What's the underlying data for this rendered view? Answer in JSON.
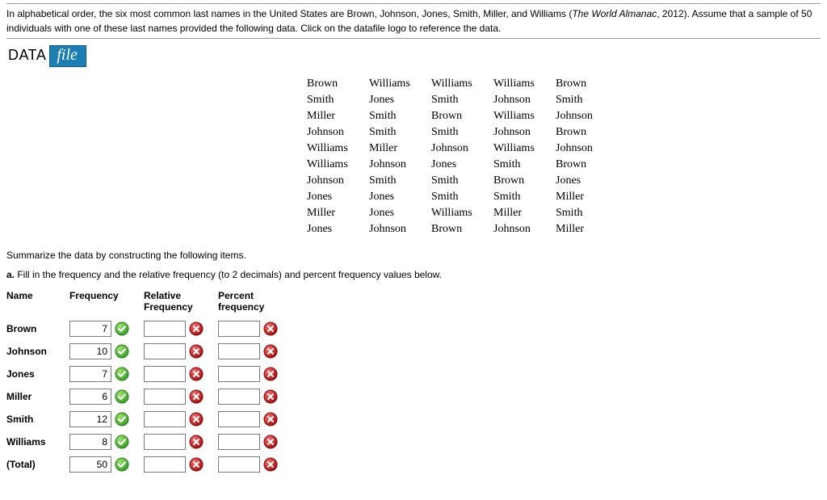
{
  "intro": {
    "text_a": "In alphabetical order, the six most common last names in the United States are Brown, Johnson, Jones, Smith, Miller, and Williams (",
    "italic": "The World Almanac",
    "text_b": ", 2012). Assume that a sample of 50 individuals with one of these last names provided the following data. Click on the datafile logo to reference the data."
  },
  "datafile": {
    "label_left": "DATA",
    "label_right": "file"
  },
  "data_rows": [
    [
      "Brown",
      "Williams",
      "Williams",
      "Williams",
      "Brown"
    ],
    [
      "Smith",
      "Jones",
      "Smith",
      "Johnson",
      "Smith"
    ],
    [
      "Miller",
      "Smith",
      "Brown",
      "Williams",
      "Johnson"
    ],
    [
      "Johnson",
      "Smith",
      "Smith",
      "Johnson",
      "Brown"
    ],
    [
      "Williams",
      "Miller",
      "Johnson",
      "Williams",
      "Johnson"
    ],
    [
      "Williams",
      "Johnson",
      "Jones",
      "Smith",
      "Brown"
    ],
    [
      "Johnson",
      "Smith",
      "Smith",
      "Brown",
      "Jones"
    ],
    [
      "Jones",
      "Jones",
      "Smith",
      "Smith",
      "Miller"
    ],
    [
      "Miller",
      "Jones",
      "Williams",
      "Miller",
      "Smith"
    ],
    [
      "Jones",
      "Johnson",
      "Brown",
      "Johnson",
      "Miller"
    ]
  ],
  "section": {
    "summarize": "Summarize the data by constructing the following items.",
    "a_label": "a.",
    "a_text": " Fill in the frequency and the relative frequency (to 2 decimals) and percent frequency values below."
  },
  "freq_headers": {
    "name": "Name",
    "freq": "Frequency",
    "rel_l1": "Relative",
    "rel_l2": "Frequency",
    "pct_l1": "Percent",
    "pct_l2": "frequency"
  },
  "freq_rows": [
    {
      "name": "Brown",
      "freq": "7",
      "freq_ok": true,
      "rel": "",
      "rel_ok": false,
      "pct": "",
      "pct_ok": false
    },
    {
      "name": "Johnson",
      "freq": "10",
      "freq_ok": true,
      "rel": "",
      "rel_ok": false,
      "pct": "",
      "pct_ok": false
    },
    {
      "name": "Jones",
      "freq": "7",
      "freq_ok": true,
      "rel": "",
      "rel_ok": false,
      "pct": "",
      "pct_ok": false
    },
    {
      "name": "Miller",
      "freq": "6",
      "freq_ok": true,
      "rel": "",
      "rel_ok": false,
      "pct": "",
      "pct_ok": false
    },
    {
      "name": "Smith",
      "freq": "12",
      "freq_ok": true,
      "rel": "",
      "rel_ok": false,
      "pct": "",
      "pct_ok": false
    },
    {
      "name": "Williams",
      "freq": "8",
      "freq_ok": true,
      "rel": "",
      "rel_ok": false,
      "pct": "",
      "pct_ok": false
    },
    {
      "name": "(Total)",
      "freq": "50",
      "freq_ok": true,
      "rel": "",
      "rel_ok": false,
      "pct": "",
      "pct_ok": false
    }
  ],
  "chart_data": {
    "type": "table",
    "title": "Last name frequency distribution (sample n=50)",
    "categories": [
      "Brown",
      "Johnson",
      "Jones",
      "Miller",
      "Smith",
      "Williams"
    ],
    "values": [
      7,
      10,
      7,
      6,
      12,
      8
    ],
    "total": 50
  }
}
